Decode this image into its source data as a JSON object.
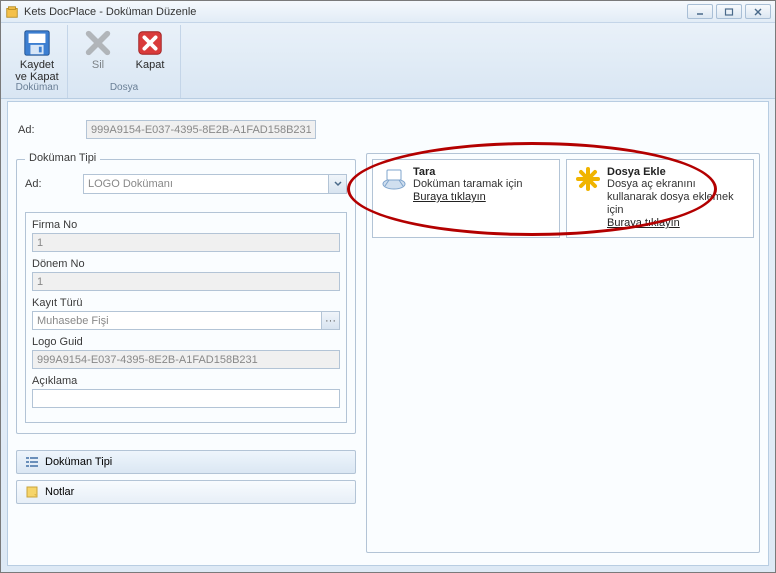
{
  "window": {
    "title": "Kets DocPlace - Doküman Düzenle"
  },
  "toolbar": {
    "group1": {
      "label": "Doküman",
      "save_close": "Kaydet\nve Kapat"
    },
    "group2": {
      "label": "Dosya",
      "delete": "Sil",
      "close": "Kapat"
    }
  },
  "ad_label": "Ad:",
  "ad_value": "999A9154-E037-4395-8E2B-A1FAD158B231",
  "groupbox_title": "Doküman Tipi",
  "form": {
    "ad_label": "Ad:",
    "ad_value": "LOGO Dokümanı",
    "firma_no_label": "Firma No",
    "firma_no_value": "1",
    "donem_no_label": "Dönem No",
    "donem_no_value": "1",
    "kayit_turu_label": "Kayıt Türü",
    "kayit_turu_value": "Muhasebe Fişi",
    "logo_guid_label": "Logo Guid",
    "logo_guid_value": "999A9154-E037-4395-8E2B-A1FAD158B231",
    "aciklama_label": "Açıklama",
    "aciklama_value": ""
  },
  "tabs": {
    "dokuman_tipi": "Doküman Tipi",
    "notlar": "Notlar"
  },
  "cards": {
    "scan": {
      "title": "Tara",
      "desc": "Doküman taramak için",
      "link": "Buraya tıklayın"
    },
    "add": {
      "title": "Dosya Ekle",
      "desc": "Dosya aç ekranını kullanarak dosya eklemek için",
      "link": "Buraya tıklayın"
    }
  }
}
